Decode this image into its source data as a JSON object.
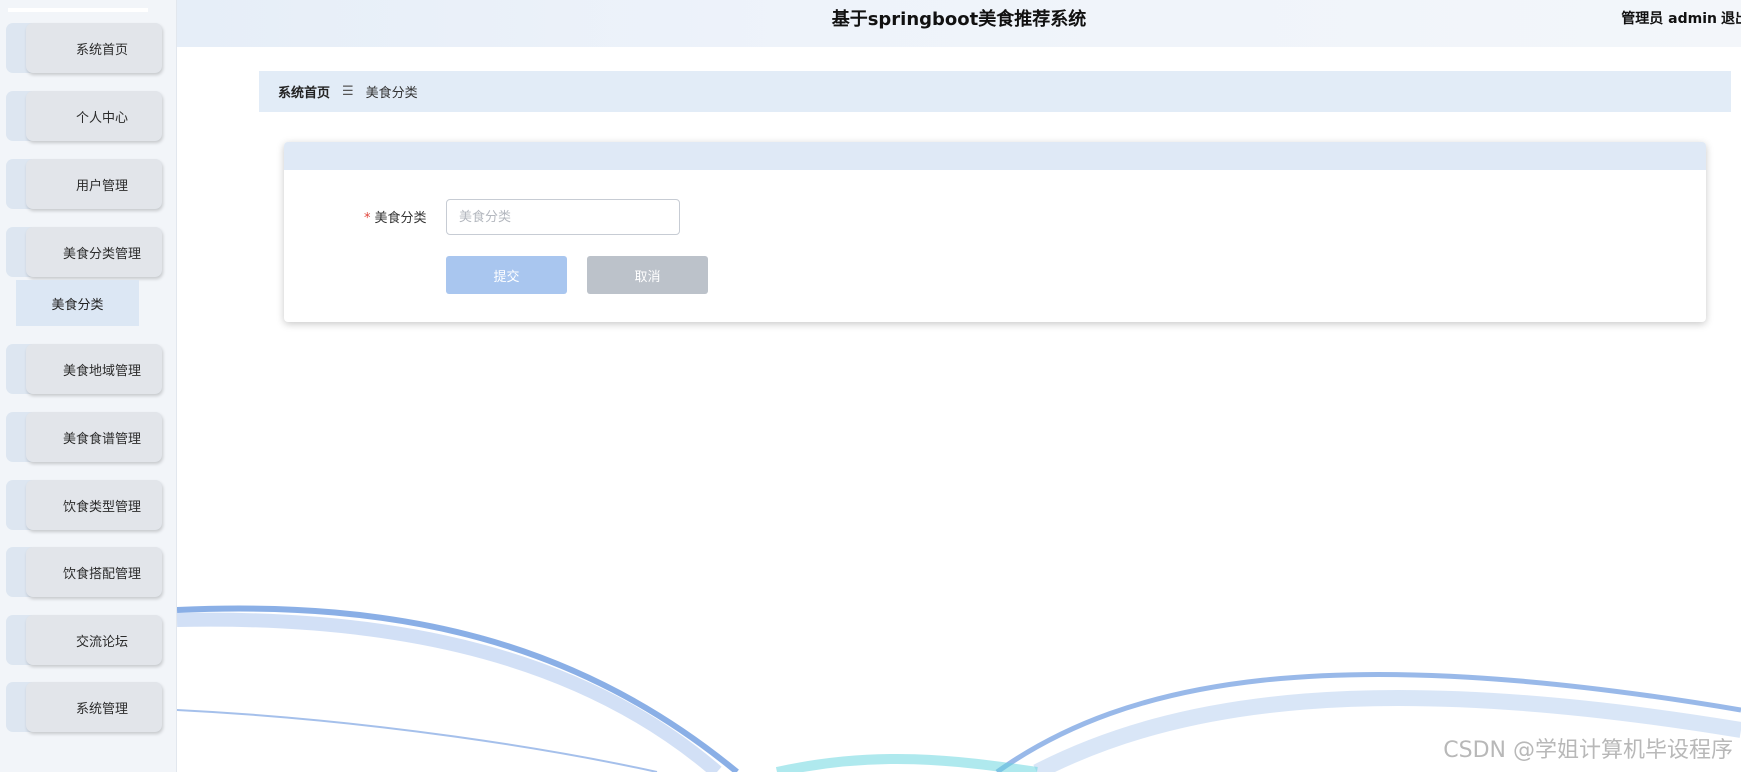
{
  "header": {
    "title": "基于springboot美食推荐系统",
    "user": "管理员 admin",
    "logout": "退出"
  },
  "sidebar": {
    "items": [
      {
        "label": "系统首页"
      },
      {
        "label": "个人中心"
      },
      {
        "label": "用户管理"
      },
      {
        "label": "美食分类管理"
      },
      {
        "label": "美食地域管理"
      },
      {
        "label": "美食食谱管理"
      },
      {
        "label": "饮食类型管理"
      },
      {
        "label": "饮食搭配管理"
      },
      {
        "label": "交流论坛"
      },
      {
        "label": "系统管理"
      }
    ],
    "submenu": {
      "label": "美食分类"
    }
  },
  "breadcrumb": {
    "home": "系统首页",
    "separator": "☰",
    "current": "美食分类"
  },
  "form": {
    "required_mark": "*",
    "label": "美食分类",
    "placeholder": "美食分类",
    "value": "",
    "submit": "提交",
    "cancel": "取消"
  },
  "watermark": "CSDN @学姐计算机毕设程序",
  "colors": {
    "accent": "#a9c6ef",
    "header_bg": "#e6eef8",
    "card_header": "#dfe9f6",
    "required": "#e0443a"
  }
}
